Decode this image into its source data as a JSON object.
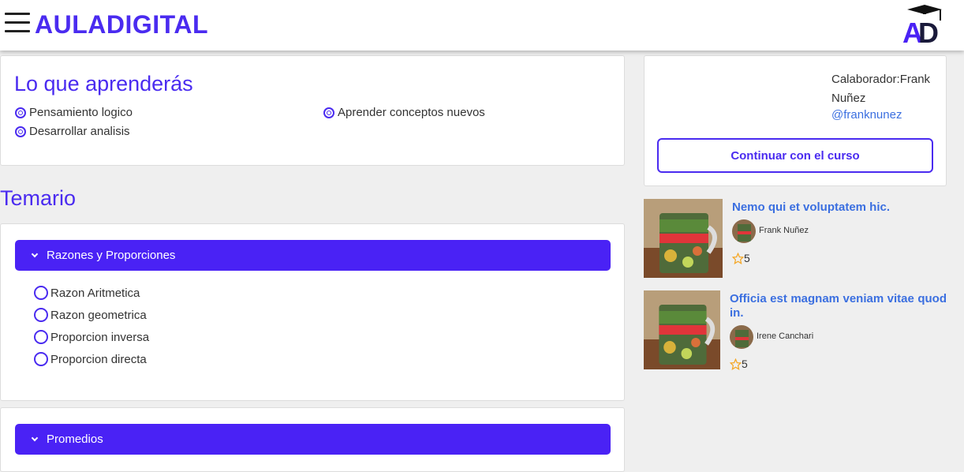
{
  "header": {
    "brand": "AULADIGITAL",
    "logo_letters": "AD"
  },
  "learn": {
    "title": "Lo que aprenderás",
    "items": [
      "Pensamiento logico",
      "Aprender conceptos nuevos",
      "Desarrollar analisis"
    ]
  },
  "temario": {
    "title": "Temario",
    "sections": [
      {
        "label": "Razones y Proporciones",
        "lessons": [
          "Razon Aritmetica",
          "Razon geometrica",
          "Proporcion inversa",
          "Proporcion directa"
        ]
      },
      {
        "label": "Promedios",
        "lessons": []
      }
    ]
  },
  "collaborator": {
    "text": "Calaborador:Frank Nuñez",
    "handle": "@franknunez",
    "continue_label": "Continuar con el curso"
  },
  "related": [
    {
      "title": "Nemo qui et voluptatem hic.",
      "author": "Frank Nuñez",
      "rating": "5"
    },
    {
      "title": "Officia est magnam veniam vitae quod in.",
      "author": "Irene Canchari",
      "rating": "5"
    }
  ],
  "colors": {
    "accent": "#4a22f5",
    "link": "#3b6fe0",
    "star": "#f5a623"
  }
}
